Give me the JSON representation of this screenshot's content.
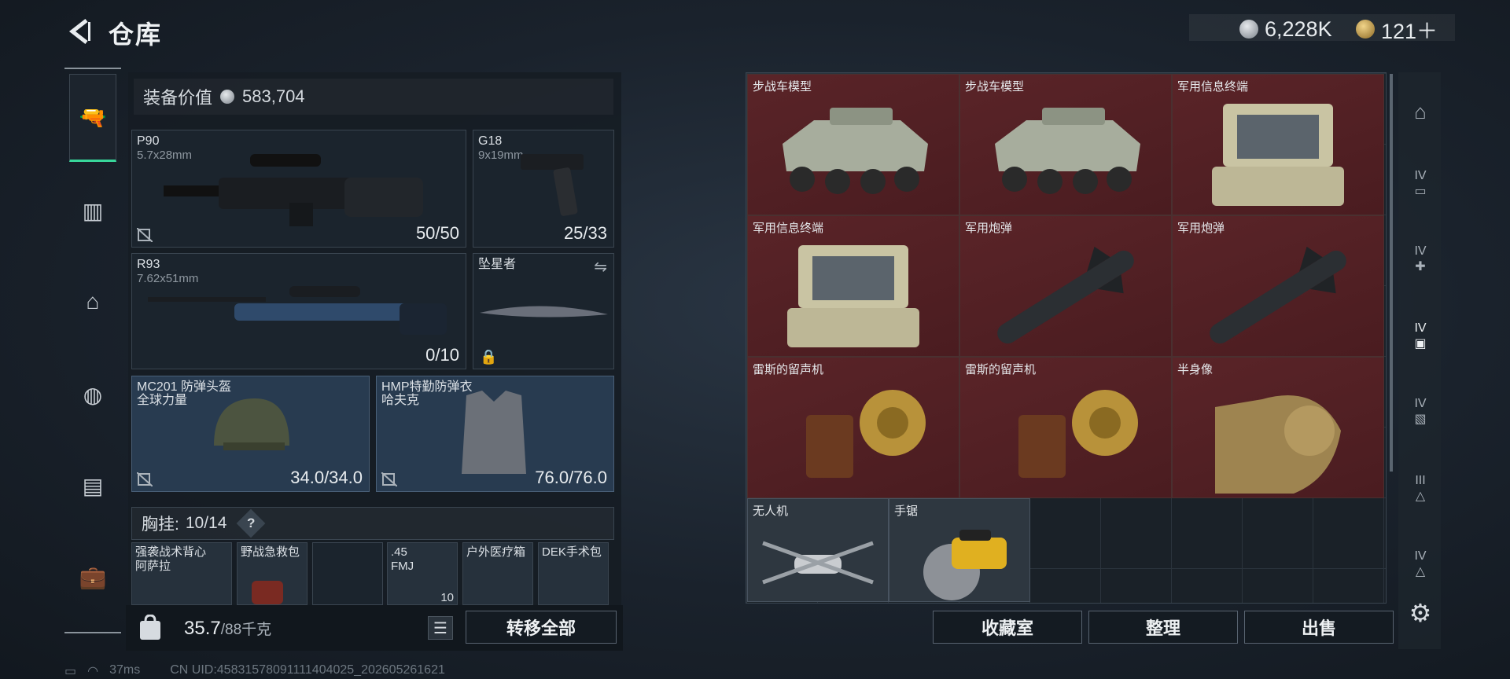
{
  "header": {
    "title": "仓库",
    "currency1": "6,228K",
    "currency2": "121＋"
  },
  "equipment": {
    "label": "装备价值",
    "value": "583,704"
  },
  "slots": [
    {
      "name": "P90",
      "sub": "5.7x28mm",
      "count": "50/50"
    },
    {
      "name": "G18",
      "sub": "9x19mm",
      "count": "25/33"
    },
    {
      "name": "R93",
      "sub": "7.62x51mm",
      "count": "0/10"
    },
    {
      "name": "坠星者",
      "sub": "",
      "count": ""
    },
    {
      "name": "MC201 防弹头盔",
      "sub": "全球力量",
      "count": "34.0/34.0"
    },
    {
      "name": "HMP特勤防弹衣",
      "sub": "哈夫克",
      "count": "76.0/76.0"
    }
  ],
  "chest": {
    "label": "胸挂:",
    "value": "10/14",
    "help": "?"
  },
  "small_items": [
    {
      "name": "强袭战术背心",
      "sub": "阿萨拉"
    },
    {
      "name": "野战急救包",
      "sub": ""
    },
    {
      "name": "",
      "sub": ""
    },
    {
      "name": ".45",
      "sub": "FMJ",
      "count": "10"
    },
    {
      "name": "户外医疗箱",
      "sub": ""
    },
    {
      "name": "DEK手术包",
      "sub": ""
    }
  ],
  "weight": {
    "value": "35.7",
    "max": "/88千克"
  },
  "buttons": {
    "transfer_all": "转移全部",
    "collection": "收藏室",
    "sort": "整理",
    "sell": "出售"
  },
  "grid_items": [
    {
      "name": "步战车模型",
      "icon": "ifv-model"
    },
    {
      "name": "步战车模型",
      "icon": "ifv-model"
    },
    {
      "name": "军用信息终端",
      "icon": "terminal"
    },
    {
      "name": "军用信息终端",
      "icon": "terminal"
    },
    {
      "name": "军用炮弹",
      "icon": "missile"
    },
    {
      "name": "军用炮弹",
      "icon": "missile"
    },
    {
      "name": "雷斯的留声机",
      "icon": "gramophone"
    },
    {
      "name": "雷斯的留声机",
      "icon": "gramophone"
    },
    {
      "name": "半身像",
      "icon": "bust"
    },
    {
      "name": "无人机",
      "icon": "drone"
    },
    {
      "name": "手锯",
      "icon": "saw"
    }
  ],
  "right_nav_labels": [
    "IV",
    "IV",
    "IV",
    "IV",
    "III",
    "IV"
  ],
  "status": {
    "ping": "37ms",
    "uid": "CN UID:45831578091111404025_202605261621"
  },
  "colors": {
    "accent": "#38d69a",
    "item_red": "#5a2428"
  }
}
